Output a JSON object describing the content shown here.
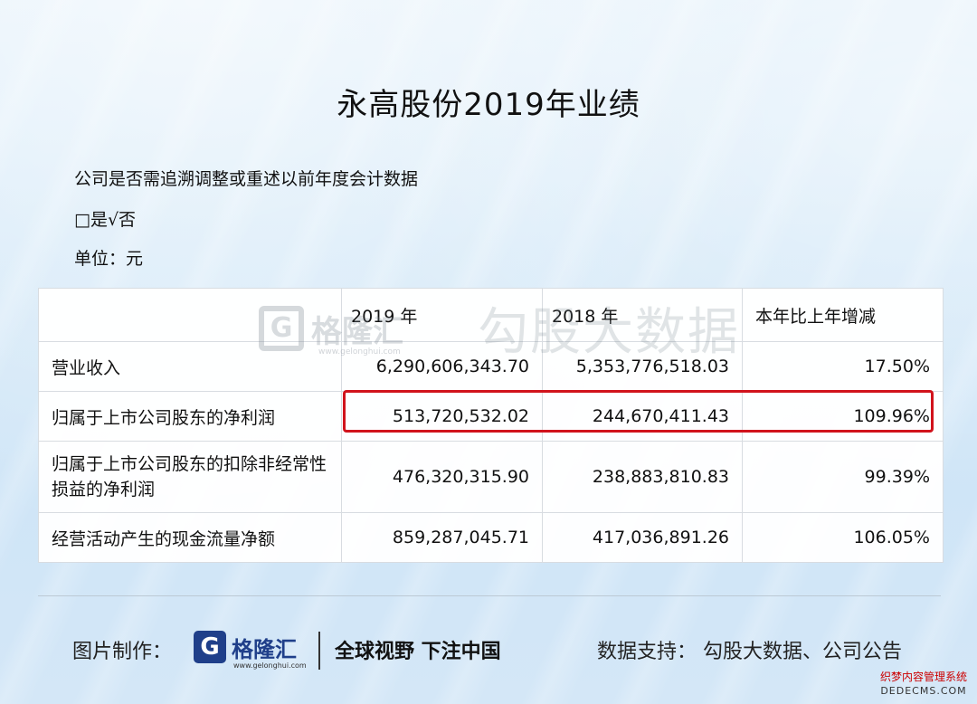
{
  "title": "永高股份2019年业绩",
  "notes": {
    "restate_question": "公司是否需追溯调整或重述以前年度会计数据",
    "restate_answer": "□是√否",
    "unit": "单位：元"
  },
  "table": {
    "headers": [
      "",
      "2019 年",
      "2018 年",
      "本年比上年增减"
    ],
    "rows": [
      {
        "label": "营业收入",
        "y2019": "6,290,606,343.70",
        "y2018": "5,353,776,518.03",
        "change": "17.50%"
      },
      {
        "label": "归属于上市公司股东的净利润",
        "y2019": "513,720,532.02",
        "y2018": "244,670,411.43",
        "change": "109.96%"
      },
      {
        "label_line1": "归属于上市公司股东的扣除非经常性",
        "label_line2": "损益的净利润",
        "y2019": "476,320,315.90",
        "y2018": "238,883,810.83",
        "change": "99.39%"
      },
      {
        "label": "经营活动产生的现金流量净额",
        "y2019": "859,287,045.71",
        "y2018": "417,036,891.26",
        "change": "106.05%"
      }
    ]
  },
  "watermarks": {
    "brand": "格隆汇",
    "brand_url": "www.gelonghui.com",
    "data_source": "勾股大数据"
  },
  "footer": {
    "made_by_label": "图片制作：",
    "logo_text": "格隆汇",
    "logo_url": "www.gelonghui.com",
    "slogan": "全球视野 下注中国",
    "data_support": "数据支持： 勾股大数据、公司公告"
  },
  "corner_mark": {
    "line1": "织梦内容管理系统",
    "line2": "DEDECMS.COM"
  },
  "colors": {
    "highlight": "#d1131c",
    "brand_blue": "#1f3f8a"
  }
}
